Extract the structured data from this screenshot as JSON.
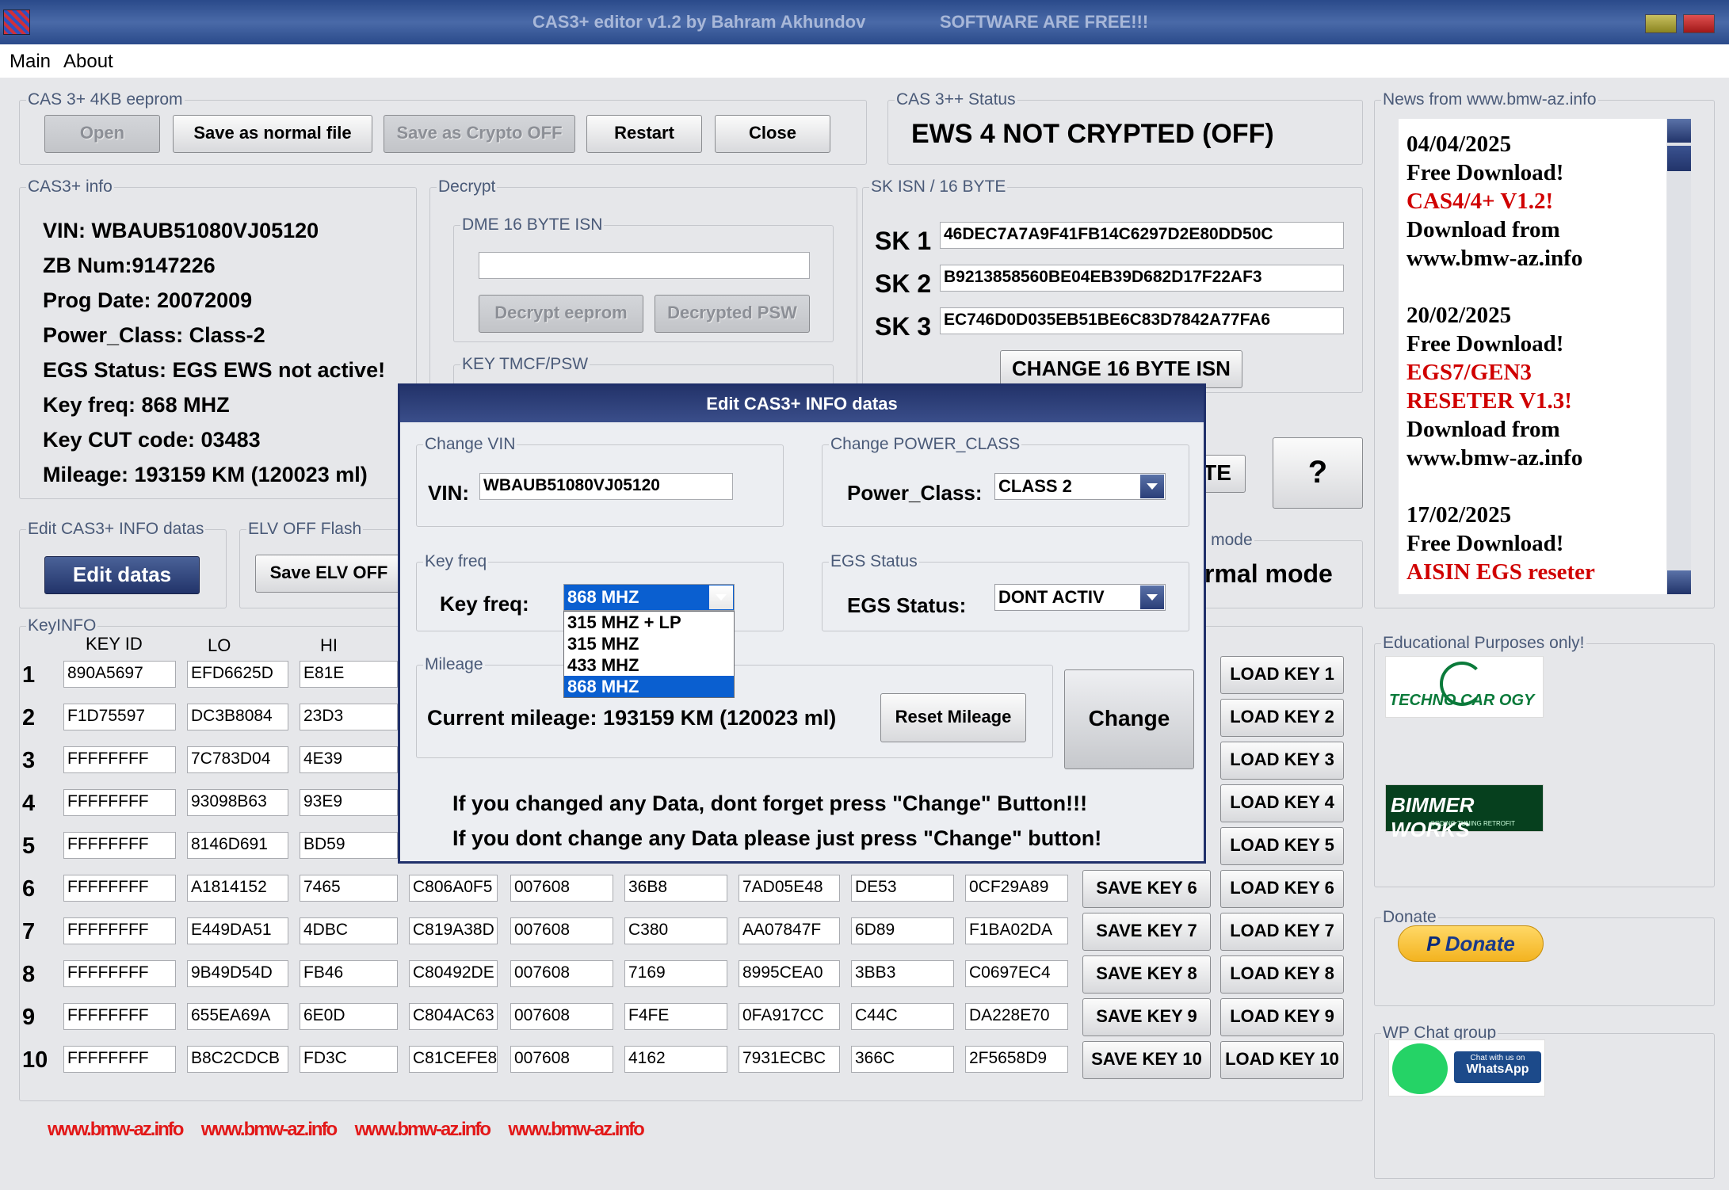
{
  "window": {
    "title": "CAS3+ editor v1.2 by Bahram Akhundov",
    "subtitle": "SOFTWARE ARE FREE!!!"
  },
  "menu": [
    "Main",
    "About"
  ],
  "eeprom": {
    "legend": "CAS 3+ 4KB eeprom",
    "buttons": [
      "Open",
      "Save as normal file",
      "Save as Crypto OFF",
      "Restart",
      "Close"
    ]
  },
  "status": {
    "legend": "CAS 3++ Status",
    "text": "EWS 4 NOT CRYPTED (OFF)"
  },
  "news": {
    "legend": "News from www.bmw-az.info",
    "items": [
      {
        "date": "04/04/2025",
        "line1": "Free Download!",
        "highlight": [
          "CAS4/4+ V1.2!"
        ],
        "line3": "Download from",
        "line4": "www.bmw-az.info"
      },
      {
        "date": "20/02/2025",
        "line1": "Free Download!",
        "highlight": [
          "EGS7/GEN3",
          "RESETER V1.3!"
        ],
        "line3": "Download from",
        "line4": "www.bmw-az.info"
      },
      {
        "date": "17/02/2025",
        "line1": "Free Download!",
        "highlight": [
          "AISIN EGS reseter"
        ],
        "line3": "",
        "line4": ""
      }
    ]
  },
  "cas_info": {
    "legend": "CAS3+ info",
    "lines": [
      "VIN: WBAUB51080VJ05120",
      "ZB Num:9147226",
      "Prog Date:  20072009",
      "Power_Class:  Class-2",
      "EGS Status:  EGS EWS not active!",
      "Key freq:  868 MHZ",
      "Key CUT code: 03483",
      "Mileage:  193159 KM (120023 ml)"
    ]
  },
  "decrypt": {
    "legend": "Decrypt",
    "dme_legend": "DME 16 BYTE ISN",
    "dme_value": "",
    "btn_decrypt_eeprom": "Decrypt eeprom",
    "btn_decrypted_psw": "Decrypted PSW",
    "tmcf_legend": "KEY TMCF/PSW"
  },
  "sk": {
    "legend": "SK ISN / 16 BYTE",
    "rows": [
      {
        "label": "SK 1",
        "value": "46DEC7A7A9F41FB14C6297D2E80DD50C"
      },
      {
        "label": "SK 2",
        "value": "B9213858560BE04EB39D682D17F22AF3"
      },
      {
        "label": "SK 3",
        "value": "EC746D0D035EB51BE6C83D7842A77FA6"
      }
    ],
    "change_btn": "CHANGE 16 BYTE ISN",
    "partial_btn": "TE",
    "help_btn": "?"
  },
  "mode": {
    "legend_partial": "+ mode",
    "text_partial": "rmal mode"
  },
  "edit": {
    "legend": "Edit CAS3+ INFO datas",
    "button": "Edit datas"
  },
  "elv": {
    "legend": "ELV OFF Flash",
    "button": "Save ELV OFF"
  },
  "keyinfo": {
    "legend": "KeyINFO",
    "headers": [
      "KEY ID",
      "LO",
      "HI"
    ],
    "rows": [
      {
        "n": "1",
        "cells": [
          "890A5697",
          "EFD6625D",
          "E81E"
        ],
        "save": "",
        "load": "LOAD KEY 1"
      },
      {
        "n": "2",
        "cells": [
          "F1D75597",
          "DC3B8084",
          "23D3"
        ],
        "save": "",
        "load": "LOAD KEY 2"
      },
      {
        "n": "3",
        "cells": [
          "FFFFFFFF",
          "7C783D04",
          "4E39"
        ],
        "save": "",
        "load": "LOAD KEY 3"
      },
      {
        "n": "4",
        "cells": [
          "FFFFFFFF",
          "93098B63",
          "93E9"
        ],
        "save": "",
        "load": "LOAD KEY 4"
      },
      {
        "n": "5",
        "cells": [
          "FFFFFFFF",
          "8146D691",
          "BD59"
        ],
        "save": "",
        "load": "LOAD KEY 5"
      },
      {
        "n": "6",
        "cells": [
          "FFFFFFFF",
          "A1814152",
          "7465",
          "C806A0F5",
          "007608",
          "36B8",
          "7AD05E48",
          "DE53",
          "0CF29A89"
        ],
        "save": "SAVE KEY 6",
        "load": "LOAD KEY 6"
      },
      {
        "n": "7",
        "cells": [
          "FFFFFFFF",
          "E449DA51",
          "4DBC",
          "C819A38D",
          "007608",
          "C380",
          "AA07847F",
          "6D89",
          "F1BA02DA"
        ],
        "save": "SAVE KEY 7",
        "load": "LOAD KEY 7"
      },
      {
        "n": "8",
        "cells": [
          "FFFFFFFF",
          "9B49D54D",
          "FB46",
          "C80492DE",
          "007608",
          "7169",
          "8995CEA0",
          "3BB3",
          "C0697EC4"
        ],
        "save": "SAVE KEY 8",
        "load": "LOAD KEY 8"
      },
      {
        "n": "9",
        "cells": [
          "FFFFFFFF",
          "655EA69A",
          "6E0D",
          "C804AC63",
          "007608",
          "F4FE",
          "0FA917CC",
          "C44C",
          "DA228E70"
        ],
        "save": "SAVE KEY 9",
        "load": "LOAD KEY 9"
      },
      {
        "n": "10",
        "cells": [
          "FFFFFFFF",
          "B8C2CDCB",
          "FD3C",
          "C81CEFE8",
          "007608",
          "4162",
          "7931ECBC",
          "366C",
          "2F5658D9"
        ],
        "save": "SAVE KEY 10",
        "load": "LOAD KEY 10"
      }
    ]
  },
  "sidebar": {
    "edu_legend": "Educational Purposes only!",
    "techno_logo": "TECHNO CAR OGY",
    "bimmer_logo": "BIMMER WORKS",
    "bimmer_sub": "CODING TUNING RETROFIT",
    "donate_legend": "Donate",
    "donate_btn": "Donate",
    "wp_legend": "WP Chat group",
    "wp_text1": "Chat with us on",
    "wp_text2": "WhatsApp"
  },
  "footer_links": [
    "www.bmw-az.info",
    "www.bmw-az.info",
    "www.bmw-az.info",
    "www.bmw-az.info"
  ],
  "dialog": {
    "title": "Edit CAS3+ INFO datas",
    "vin_legend": "Change VIN",
    "vin_label": "VIN:",
    "vin_value": "WBAUB51080VJ05120",
    "power_legend": "Change POWER_CLASS",
    "power_label": "Power_Class:",
    "power_value": "CLASS 2",
    "keyfreq_legend": "Key freq",
    "keyfreq_label": "Key freq:",
    "keyfreq_value": "868 MHZ",
    "keyfreq_options": [
      "315 MHZ + LP",
      "315 MHZ",
      "433 MHZ",
      "868 MHZ"
    ],
    "egs_legend": "EGS Status",
    "egs_label": "EGS Status:",
    "egs_value": "DONT ACTIV",
    "mileage_legend": "Mileage",
    "mileage_text": "Current mileage: 193159 KM (120023 ml)",
    "reset_btn": "Reset Mileage",
    "change_btn": "Change",
    "note1": "If you changed any Data, dont forget press \"Change\" Button!!!",
    "note2": "If you dont change any Data please just press \"Change\" button!"
  },
  "colors": {
    "accent": "#22346a",
    "news_red": "#d00000",
    "link_red": "#e21818"
  }
}
